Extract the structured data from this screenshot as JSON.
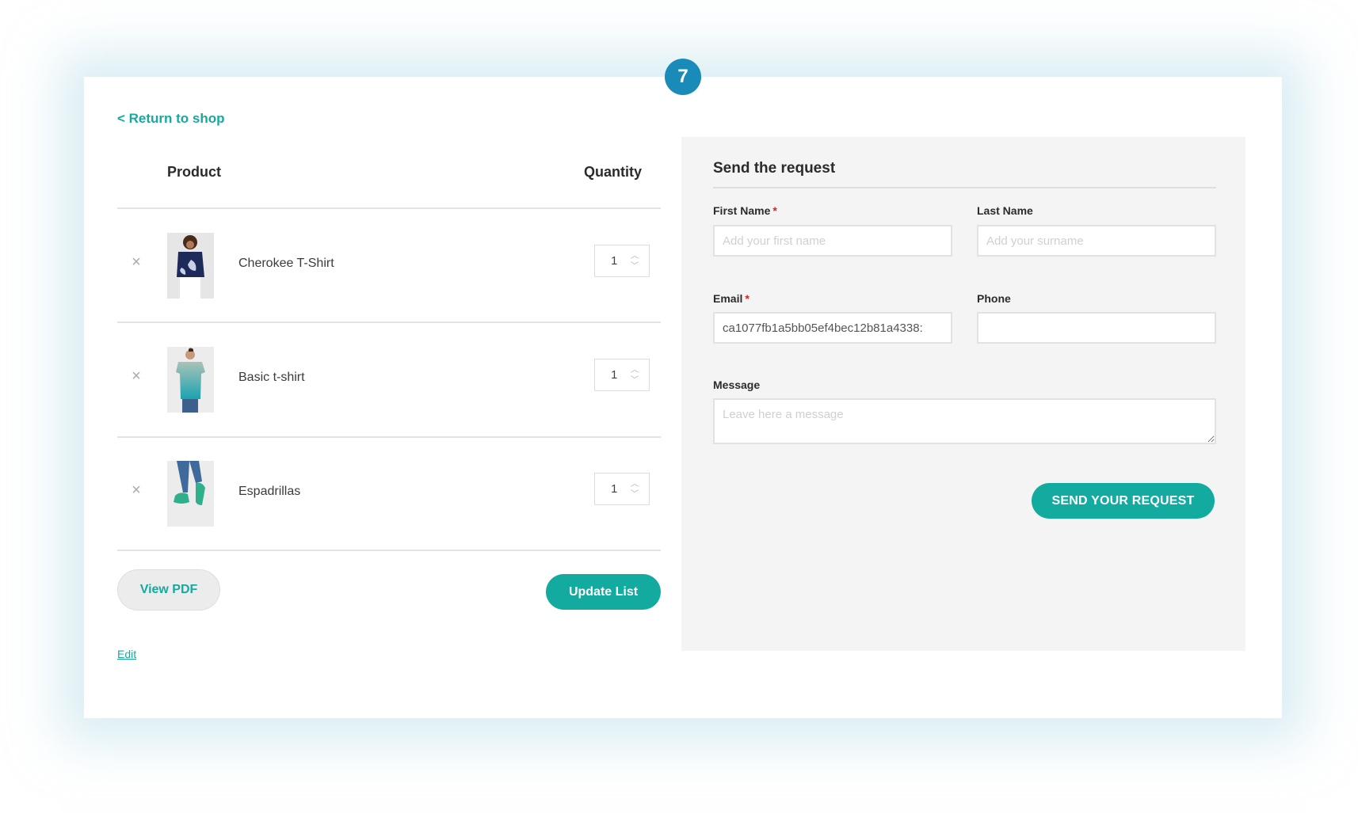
{
  "badge": {
    "number": "7",
    "color": "#1a8ab8"
  },
  "nav": {
    "return_label": "< Return to shop"
  },
  "table": {
    "headers": {
      "product": "Product",
      "quantity": "Quantity"
    },
    "rows": [
      {
        "name": "Cherokee T-Shirt",
        "quantity": "1",
        "remove_icon": "close-icon"
      },
      {
        "name": "Basic t-shirt",
        "quantity": "1",
        "remove_icon": "close-icon"
      },
      {
        "name": "Espadrillas",
        "quantity": "1",
        "remove_icon": "close-icon"
      }
    ]
  },
  "actions": {
    "view_pdf_label": "View PDF",
    "update_list_label": "Update List",
    "edit_label": "Edit"
  },
  "form": {
    "title": "Send the request",
    "first_name": {
      "label": "First Name",
      "required": "*",
      "placeholder": "Add your first name",
      "value": ""
    },
    "last_name": {
      "label": "Last Name",
      "placeholder": "Add your surname",
      "value": ""
    },
    "email": {
      "label": "Email",
      "required": "*",
      "value": "ca1077fb1a5bb05ef4bec12b81a4338:"
    },
    "phone": {
      "label": "Phone",
      "value": ""
    },
    "message": {
      "label": "Message",
      "placeholder": "Leave here a message",
      "value": ""
    },
    "submit_label": "SEND YOUR REQUEST"
  },
  "colors": {
    "accent": "#13aaa0",
    "link": "#17a99e",
    "panel_bg": "#f4f4f4",
    "required": "#e02020"
  }
}
